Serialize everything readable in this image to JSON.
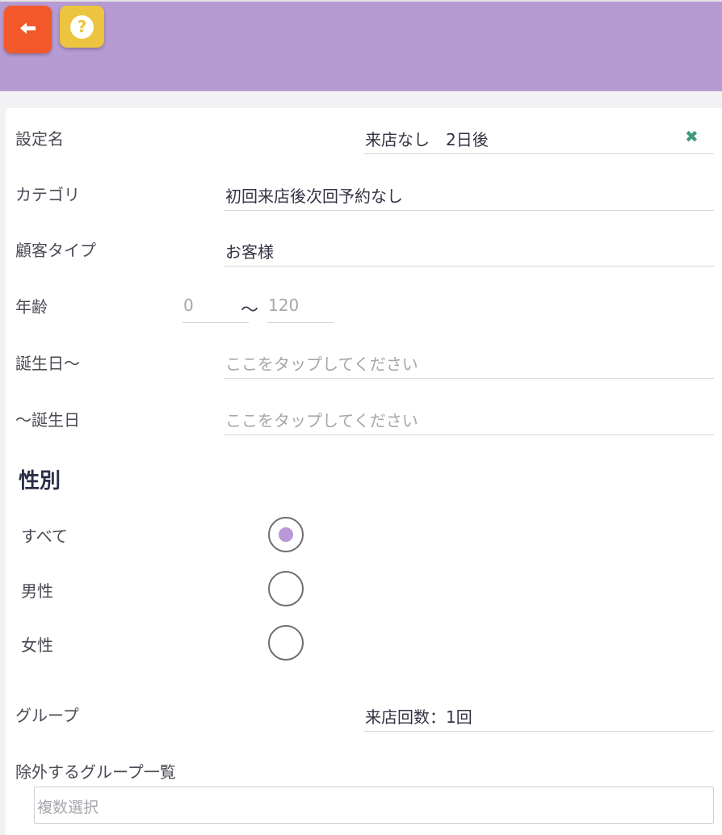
{
  "header": {
    "back_icon": "arrow-left-icon",
    "help_icon": "question-icon",
    "help_glyph": "?",
    "colors": {
      "header_bg": "#b69bd3",
      "back_button": "#f2582a",
      "help_button": "#ecc43f"
    }
  },
  "form": {
    "setting_name": {
      "label": "設定名",
      "value": "来店なし　2日後",
      "clear_icon": "close-icon",
      "clear_glyph": "✖"
    },
    "category": {
      "label": "カテゴリ",
      "value": "初回来店後次回予約なし"
    },
    "customer_type": {
      "label": "顧客タイプ",
      "value": "お客様"
    },
    "age": {
      "label": "年齢",
      "min_placeholder": "0",
      "separator": "〜",
      "max_placeholder": "120"
    },
    "birthday_from": {
      "label": "誕生日〜",
      "placeholder": "ここをタップしてください"
    },
    "birthday_to": {
      "label": "〜誕生日",
      "placeholder": "ここをタップしてください"
    },
    "gender": {
      "title": "性別",
      "options": [
        {
          "label": "すべて",
          "selected": true
        },
        {
          "label": "男性",
          "selected": false
        },
        {
          "label": "女性",
          "selected": false
        }
      ],
      "selected_color": "#b898d6"
    },
    "group": {
      "label": "グループ",
      "value": "来店回数：1回"
    },
    "exclude_groups": {
      "label": "除外するグループ一覧",
      "placeholder": "複数選択"
    }
  }
}
